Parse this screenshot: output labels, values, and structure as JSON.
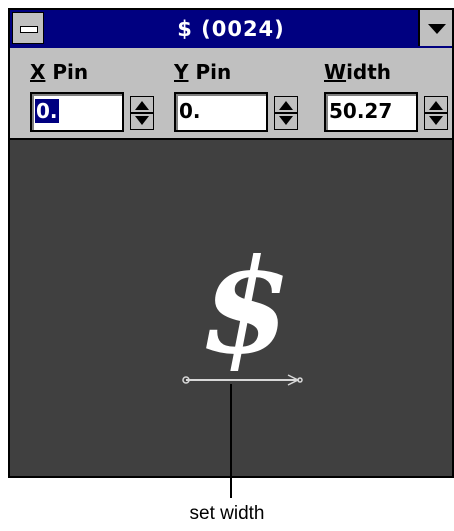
{
  "window": {
    "title": "$ (0024)"
  },
  "fields": [
    {
      "label_key": "X",
      "label_rest": " Pin",
      "value": "0."
    },
    {
      "label_key": "Y",
      "label_rest": " Pin",
      "value": "0."
    },
    {
      "label_key": "W",
      "label_rest": "idth",
      "value": "50.27"
    }
  ],
  "preview": {
    "glyph": "$"
  },
  "caption": "set width",
  "colors": {
    "titlebar": "#000080",
    "chrome": "#c0c0c0",
    "canvas": "#404040",
    "selection": "#000080"
  }
}
